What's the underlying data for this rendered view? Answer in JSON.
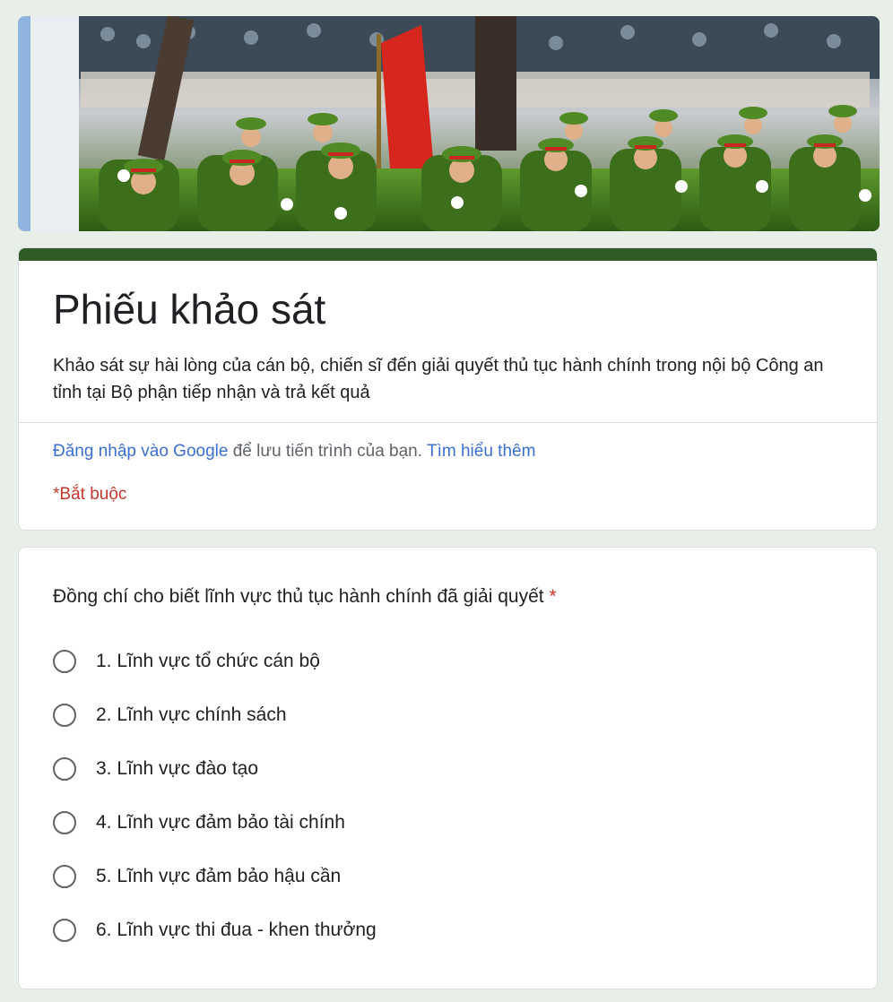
{
  "banner": {
    "image_name": "military-parade-banner"
  },
  "header": {
    "title": "Phiếu khảo sát",
    "description": "Khảo sát sự hài lòng của cán bộ, chiến sĩ đến giải quyết thủ tục hành chính trong nội bộ Công an tỉnh tại Bộ phận tiếp nhận và trả kết quả",
    "signin_link": "Đăng nhập vào Google",
    "signin_text": "để lưu tiến trình của bạn.",
    "learn_more": "Tìm hiểu thêm",
    "required_note": "*Bắt buộc",
    "accent_color": "#2f5c25"
  },
  "question": {
    "title": "Đồng chí cho biết lĩnh vực thủ tục hành chính đã giải quyết",
    "required_mark": "*",
    "options": [
      "1. Lĩnh vực tổ chức cán bộ",
      "2. Lĩnh vực chính sách",
      "3. Lĩnh vực đào tạo",
      "4. Lĩnh vực đảm bảo tài chính",
      "5. Lĩnh vực đảm bảo hậu cần",
      "6. Lĩnh vực thi đua - khen thưởng"
    ]
  }
}
